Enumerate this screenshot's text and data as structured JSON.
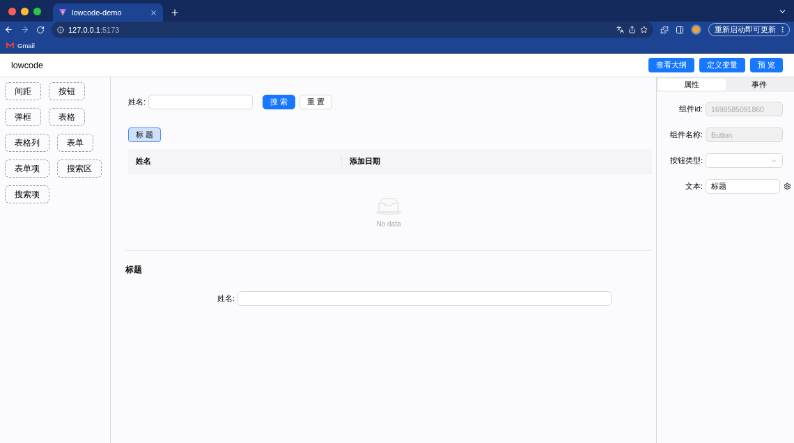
{
  "browser": {
    "tab_title": "lowcode-demo",
    "url_host": "127.0.0.1",
    "url_port": ":5173",
    "bookmarks": [
      "Gmail"
    ],
    "update_button": "重新启动即可更新"
  },
  "header": {
    "logo": "lowcode",
    "buttons": [
      "查看大纲",
      "定义变量",
      "预 览"
    ]
  },
  "components": [
    "间距",
    "按钮",
    "弹框",
    "表格",
    "表格列",
    "表单",
    "表单项",
    "搜索区",
    "搜索项"
  ],
  "canvas": {
    "search_form": {
      "label": "姓名:",
      "buttons": [
        {
          "label": "搜 索",
          "kind": "primary"
        },
        {
          "label": "重 置",
          "kind": "default"
        }
      ]
    },
    "title_button": {
      "label": "标 题",
      "selected": true
    },
    "table": {
      "columns": [
        "姓名",
        "添加日期"
      ],
      "empty_text": "No data"
    },
    "section_title": "标题",
    "form": {
      "fields": [
        {
          "label": "姓名:"
        }
      ]
    }
  },
  "properties": {
    "tabs": [
      {
        "label": "属性",
        "selected": true
      },
      {
        "label": "事件",
        "selected": false
      }
    ],
    "fields": [
      {
        "label": "组件id:",
        "kind": "input",
        "value": "1698585091860",
        "disabled": true
      },
      {
        "label": "组件名称:",
        "kind": "input",
        "value": "Button",
        "disabled": true
      },
      {
        "label": "按钮类型:",
        "kind": "select"
      },
      {
        "label": "文本:",
        "kind": "setting_input",
        "value": "标题",
        "disabled": false
      }
    ]
  }
}
